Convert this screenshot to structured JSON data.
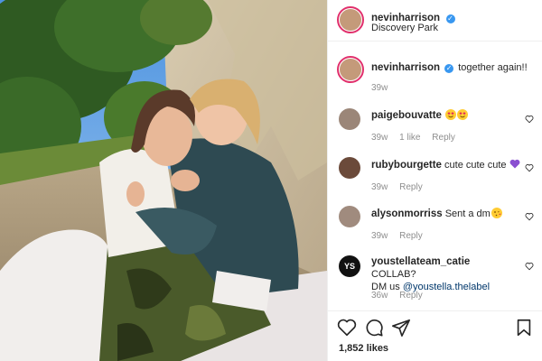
{
  "post": {
    "author": "nevinharrison",
    "location": "Discovery Park",
    "caption": "together again!!",
    "caption_age": "39w",
    "likes": "1,852 likes"
  },
  "comments": [
    {
      "user": "paigebouvatte",
      "text": "",
      "emojis": [
        "smiling-face-with-heart-eyes",
        "smiling-face-with-heart-eyes"
      ],
      "age": "39w",
      "likes": "1 like",
      "reply": "Reply",
      "avatar_color": "#9b8678"
    },
    {
      "user": "rubybourgette",
      "text": "cute cute cute",
      "emojis": [
        "purple-heart"
      ],
      "age": "39w",
      "reply": "Reply",
      "avatar_color": "#6b4a3a"
    },
    {
      "user": "alysonmorriss",
      "text": "Sent a dm",
      "emojis": [
        "face-blowing-a-kiss"
      ],
      "age": "39w",
      "reply": "Reply",
      "avatar_color": "#a08b7e"
    },
    {
      "user": "youstellateam_catie",
      "text_line1": "COLLAB?",
      "text_line2": "DM us",
      "mention": "@youstella.thelabel",
      "age": "36w",
      "reply": "Reply",
      "avatar_color": "#111111",
      "avatar_text": "YS"
    }
  ],
  "icons": [
    "like-icon",
    "comment-icon",
    "share-icon",
    "save-icon",
    "verified-icon"
  ],
  "colors": {
    "verified": "#3897f0",
    "ring": "#e1306c",
    "muted": "#8e8e8e",
    "link": "#00376b"
  }
}
